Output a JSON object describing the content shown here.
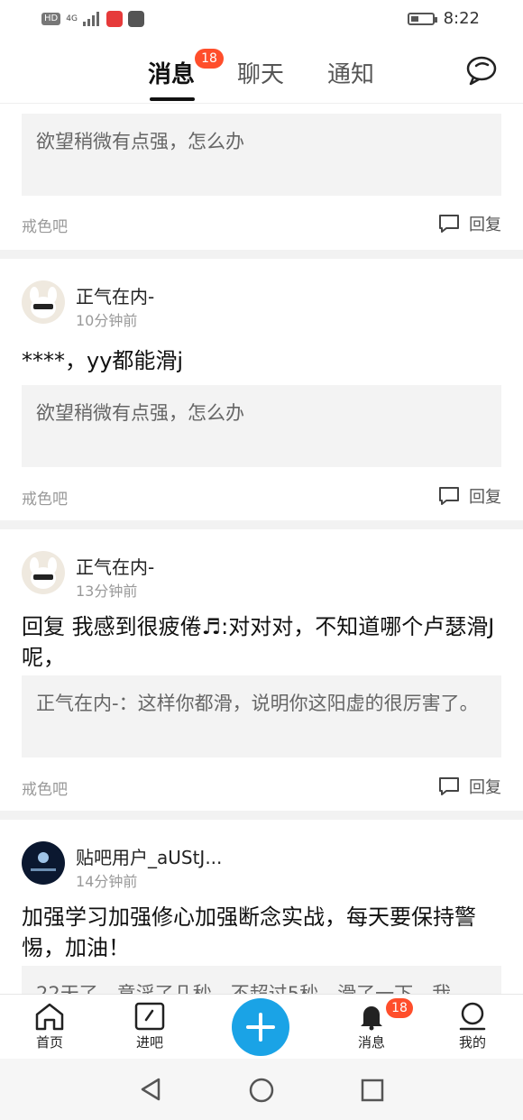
{
  "status_bar": {
    "left_badge": "HD",
    "network": "4G",
    "time": "8:22"
  },
  "tabs": [
    {
      "label": "消息",
      "badge": "18"
    },
    {
      "label": "聊天"
    },
    {
      "label": "通知"
    }
  ],
  "posts": [
    {
      "username": "",
      "time": "",
      "content": "",
      "quote": "欲望稍微有点强，怎么办",
      "forum": "戒色吧",
      "reply_label": "回复"
    },
    {
      "username": "正气在内-",
      "time": "10分钟前",
      "content": "****，yy都能滑j",
      "quote": "欲望稍微有点强，怎么办",
      "forum": "戒色吧",
      "reply_label": "回复"
    },
    {
      "username": "正气在内-",
      "time": "13分钟前",
      "content": "回复 我感到很疲倦♬:对对对，不知道哪个卢瑟滑J呢，",
      "quote": "正气在内-：这样你都滑，说明你这阳虚的很厉害了。",
      "forum": "戒色吧",
      "reply_label": "回复"
    },
    {
      "username": "贴吧用户_aUStJ...",
      "time": "14分钟前",
      "content": "加强学习加强修心加强断念实战，每天要保持警惕，加油！",
      "quote": "22天了，意淫了几秒，不超过5秒，滑了一下，我"
    }
  ],
  "bottom_nav": {
    "items": [
      {
        "label": "首页"
      },
      {
        "label": "进吧"
      },
      {
        "label": "消息",
        "badge": "18"
      },
      {
        "label": "我的"
      }
    ]
  },
  "colors": {
    "accent": "#1aa3e6",
    "badge": "#ff4e2b"
  }
}
